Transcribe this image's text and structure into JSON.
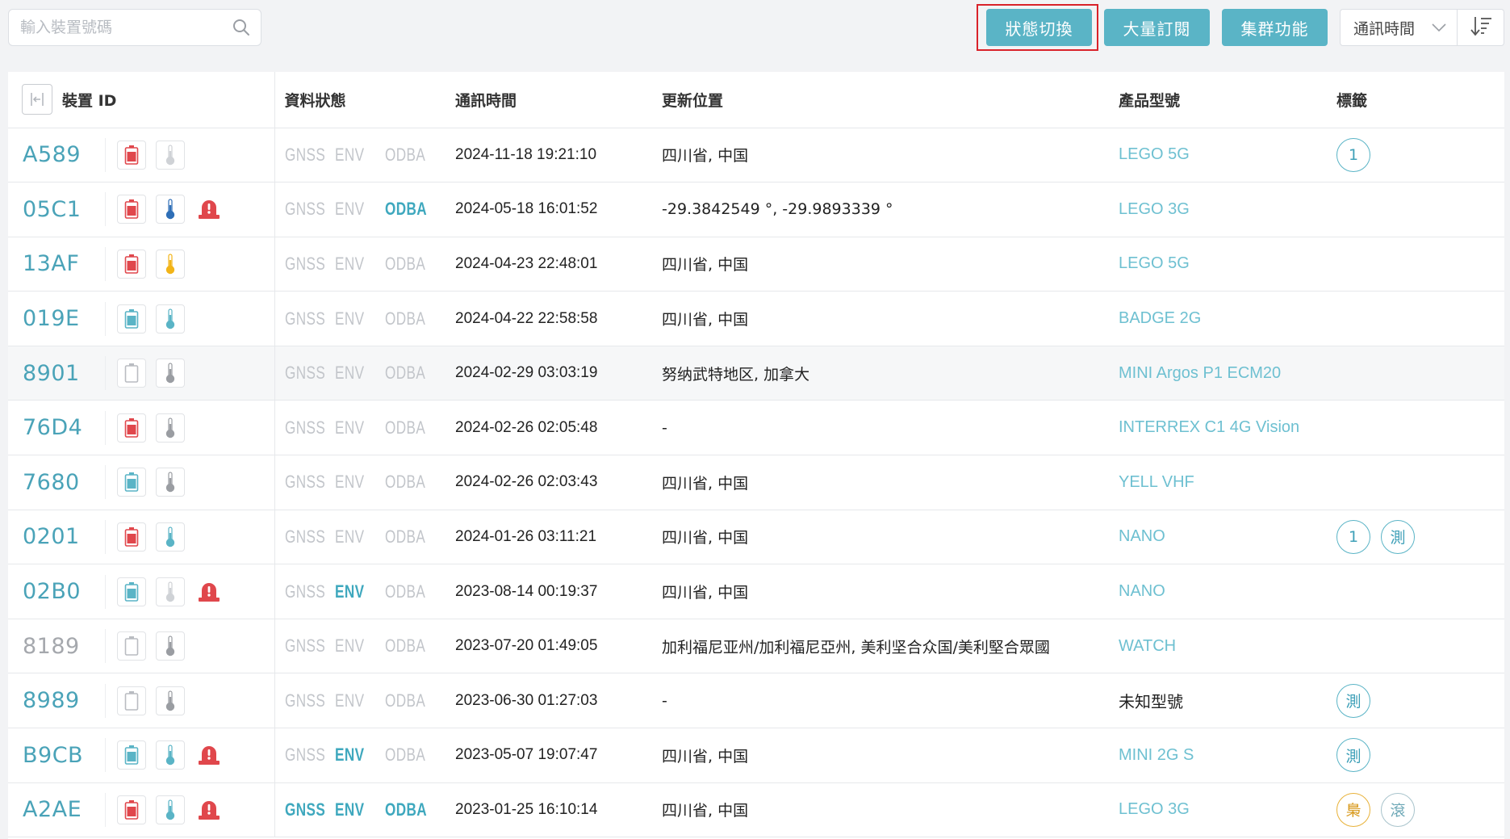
{
  "toolbar": {
    "search_placeholder": "輸入裝置號碼",
    "buttons": {
      "status_toggle": "狀態切換",
      "bulk_subscribe": "大量訂閱",
      "cluster": "集群功能"
    },
    "sort_by": "通訊時間",
    "sort_order_icon": "sort-descending-icon"
  },
  "colors": {
    "accent": "#5ab4c6",
    "battery_red": "#e0474c",
    "battery_teal": "#5ab4c6",
    "alarm_red": "#e0474c",
    "therm_blue": "#2f6fb7",
    "therm_gold": "#f2b418",
    "therm_teal": "#5ab4c6",
    "therm_gray": "#9a9da2"
  },
  "table": {
    "headers": {
      "device_id": "裝置 ID",
      "data_status": "資料狀態",
      "comm_time": "通訊時間",
      "location": "更新位置",
      "model": "產品型號",
      "tags": "標籤"
    },
    "status_labels": [
      "GNSS",
      "ENV",
      "ODBA"
    ],
    "rows": [
      {
        "id": "A589",
        "id_gray": false,
        "battery": "red",
        "therm": "light",
        "alarm": false,
        "gnss": false,
        "env": false,
        "odba": false,
        "time": "2024-11-18 19:21:10",
        "location": "四川省, 中国",
        "model": "LEGO 5G",
        "model_plain": false,
        "tags": [
          {
            "text": "1",
            "style": "teal"
          }
        ],
        "hover": false
      },
      {
        "id": "05C1",
        "id_gray": false,
        "battery": "red",
        "therm": "blue",
        "alarm": true,
        "gnss": false,
        "env": false,
        "odba": true,
        "time": "2024-05-18 16:01:52",
        "location": "-29.3842549 °, -29.9893339 °",
        "model": "LEGO 3G",
        "model_plain": false,
        "tags": [],
        "hover": false
      },
      {
        "id": "13AF",
        "id_gray": false,
        "battery": "red",
        "therm": "gold",
        "alarm": false,
        "gnss": false,
        "env": false,
        "odba": false,
        "time": "2024-04-23 22:48:01",
        "location": "四川省, 中国",
        "model": "LEGO 5G",
        "model_plain": false,
        "tags": [],
        "hover": false
      },
      {
        "id": "019E",
        "id_gray": false,
        "battery": "teal",
        "therm": "teal",
        "alarm": false,
        "gnss": false,
        "env": false,
        "odba": false,
        "time": "2024-04-22 22:58:58",
        "location": "四川省, 中国",
        "model": "BADGE 2G",
        "model_plain": false,
        "tags": [],
        "hover": false
      },
      {
        "id": "8901",
        "id_gray": false,
        "battery": "empty",
        "therm": "gray",
        "alarm": false,
        "gnss": false,
        "env": false,
        "odba": false,
        "time": "2024-02-29 03:03:19",
        "location": "努纳武特地区, 加拿大",
        "model": "MINI Argos P1 ECM20",
        "model_plain": false,
        "tags": [],
        "hover": true
      },
      {
        "id": "76D4",
        "id_gray": false,
        "battery": "red",
        "therm": "gray",
        "alarm": false,
        "gnss": false,
        "env": false,
        "odba": false,
        "time": "2024-02-26 02:05:48",
        "location": "-",
        "model": "INTERREX C1 4G Vision",
        "model_plain": false,
        "tags": [],
        "hover": false
      },
      {
        "id": "7680",
        "id_gray": false,
        "battery": "teal",
        "therm": "gray",
        "alarm": false,
        "gnss": false,
        "env": false,
        "odba": false,
        "time": "2024-02-26 02:03:43",
        "location": "四川省, 中国",
        "model": "YELL VHF",
        "model_plain": false,
        "tags": [],
        "hover": false
      },
      {
        "id": "0201",
        "id_gray": false,
        "battery": "red",
        "therm": "teal",
        "alarm": false,
        "gnss": false,
        "env": false,
        "odba": false,
        "time": "2024-01-26 03:11:21",
        "location": "四川省, 中国",
        "model": "NANO",
        "model_plain": false,
        "tags": [
          {
            "text": "1",
            "style": "teal"
          },
          {
            "text": "測",
            "style": "teal"
          }
        ],
        "hover": false
      },
      {
        "id": "02B0",
        "id_gray": false,
        "battery": "teal",
        "therm": "light",
        "alarm": true,
        "gnss": false,
        "env": true,
        "odba": false,
        "time": "2023-08-14 00:19:37",
        "location": "四川省, 中国",
        "model": "NANO",
        "model_plain": false,
        "tags": [],
        "hover": false
      },
      {
        "id": "8189",
        "id_gray": true,
        "battery": "empty",
        "therm": "gray",
        "alarm": false,
        "gnss": false,
        "env": false,
        "odba": false,
        "time": "2023-07-20 01:49:05",
        "location": "加利福尼亚州/加利福尼亞州, 美利坚合众国/美利堅合眾國",
        "model": "WATCH",
        "model_plain": false,
        "tags": [],
        "hover": false
      },
      {
        "id": "8989",
        "id_gray": false,
        "battery": "empty",
        "therm": "gray",
        "alarm": false,
        "gnss": false,
        "env": false,
        "odba": false,
        "time": "2023-06-30 01:27:03",
        "location": "-",
        "model": "未知型號",
        "model_plain": true,
        "tags": [
          {
            "text": "測",
            "style": "teal"
          }
        ],
        "hover": false
      },
      {
        "id": "B9CB",
        "id_gray": false,
        "battery": "teal",
        "therm": "teal",
        "alarm": true,
        "gnss": false,
        "env": true,
        "odba": false,
        "time": "2023-05-07 19:07:47",
        "location": "四川省, 中国",
        "model": "MINI 2G S",
        "model_plain": false,
        "tags": [
          {
            "text": "測",
            "style": "teal"
          }
        ],
        "hover": false
      },
      {
        "id": "A2AE",
        "id_gray": false,
        "battery": "red",
        "therm": "teal",
        "alarm": true,
        "gnss": true,
        "env": true,
        "odba": true,
        "time": "2023-01-25 16:10:14",
        "location": "四川省, 中国",
        "model": "LEGO 3G",
        "model_plain": false,
        "tags": [
          {
            "text": "梟",
            "style": "gold"
          },
          {
            "text": "滾",
            "style": "gray"
          }
        ],
        "hover": false
      }
    ]
  }
}
